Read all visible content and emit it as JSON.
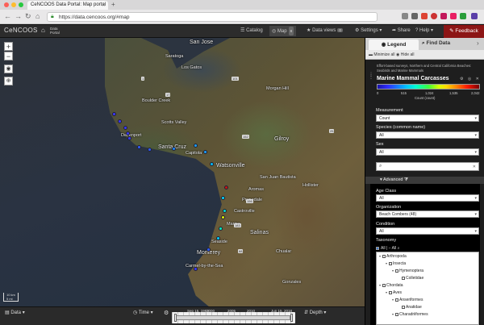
{
  "browser": {
    "tab_title": "CeNCOOS Data Portal: Map portal",
    "url": "https://data.cencoos.org/#map",
    "new_tab": "+"
  },
  "topbar": {
    "logo": "CeNCOOS",
    "portal_label_1": "Data",
    "portal_label_2": "Portal",
    "catalog": "Catalog",
    "map": "Map",
    "map_badge": "8",
    "data_views": "Data views",
    "data_views_badge": "0",
    "settings": "Settings",
    "share": "Share",
    "help": "Help",
    "feedback": "Feedback"
  },
  "map": {
    "labels": [
      "San Jose",
      "Saratoga",
      "Los Gatos",
      "Boulder Creek",
      "Scotts Valley",
      "Davenport",
      "Santa Cruz",
      "Capitola",
      "Watsonville",
      "Morgan Hill",
      "Gilroy",
      "Hollister",
      "Castroville",
      "Marina",
      "Salinas",
      "Seaside",
      "Monterey",
      "Carmel-by-the-Sea",
      "Chualar",
      "Gonzales",
      "San Juan Bautista",
      "Aromas",
      "Prunedale"
    ],
    "shields": [
      "101",
      "152",
      "17",
      "1",
      "156",
      "183",
      "68",
      "25"
    ],
    "scale_label": "10 km",
    "scale_label2": "5 mi",
    "zoom_in": "+",
    "zoom_out": "−"
  },
  "bottombar": {
    "data_menu": "Data",
    "time_menu": "Time",
    "depth_menu": "Depth",
    "start_label": "Sep 15, 1993",
    "end_label": "Jun 15, 2018",
    "years": [
      "2000",
      "2005",
      "2010",
      "2015"
    ]
  },
  "panel": {
    "tab_legend": "Legend",
    "tab_find": "Find Data",
    "minimize_all": "Minimize all",
    "hide_all": "Hide all",
    "layer_description": "Effort-based surveys, Northern and Central California Beaches: Seabirds and Marine Mammals",
    "layer_title": "Marine Mammal Carcasses",
    "colorbar_ticks": [
      "0",
      "515",
      "1,024",
      "1,535",
      "2,042"
    ],
    "colorbar_unit": "Count (count)",
    "measurement_label": "Measurement",
    "measurement_value": "Count",
    "species_label": "Species (common name)",
    "species_value": "All",
    "sex_label": "Sex",
    "sex_value": "All",
    "advanced_label": "Advanced",
    "age_label": "Age Class",
    "age_value": "All",
    "org_label": "Organization",
    "org_value": "Beach Combers (48)",
    "condition_label": "Condition",
    "condition_value": "All",
    "taxonomy_label": "Taxonomy",
    "all_toggle": "All | − All",
    "tree": [
      "Arthropoda",
      "Insecta",
      "Hymenoptera",
      "Colletidae",
      "Chordata",
      "Aves",
      "Anseriformes",
      "Anatidae",
      "Charadriiformes"
    ]
  },
  "colors": {
    "feedback": "#8c1515",
    "topbar": "#2c2c2c",
    "panel": "#1e1e1e"
  },
  "points": [
    {
      "value": 180,
      "color": "#3b37ff"
    },
    {
      "value": 220,
      "color": "#3b37ff"
    },
    {
      "value": 260,
      "color": "#3a3aff"
    },
    {
      "value": 300,
      "color": "#3a3aff"
    },
    {
      "value": 250,
      "color": "#3a3aff"
    },
    {
      "value": 350,
      "color": "#2f5dff"
    },
    {
      "value": 380,
      "color": "#2f5dff"
    },
    {
      "value": 420,
      "color": "#1a85ff"
    },
    {
      "value": 480,
      "color": "#1aa0ff"
    },
    {
      "value": 520,
      "color": "#1aa0ff"
    },
    {
      "value": 600,
      "color": "#00c0ff"
    },
    {
      "value": 2000,
      "color": "#c81414"
    },
    {
      "value": 700,
      "color": "#00d6ff"
    },
    {
      "value": 760,
      "color": "#00e0d8"
    },
    {
      "value": 1300,
      "color": "#e0f000"
    },
    {
      "value": 800,
      "color": "#00f0c0"
    },
    {
      "value": 750,
      "color": "#00d0ff"
    },
    {
      "value": 400,
      "color": "#2f5dff"
    },
    {
      "value": 300,
      "color": "#3a3aff"
    }
  ]
}
